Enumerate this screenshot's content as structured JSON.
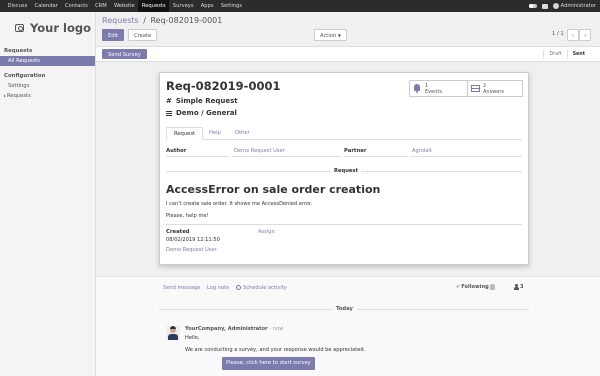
{
  "topbar": {
    "menu": [
      "Discuss",
      "Calendar",
      "Contacts",
      "CRM",
      "Website",
      "Requests",
      "Surveys",
      "Apps",
      "Settings"
    ],
    "active_index": 5,
    "user": "Administrator"
  },
  "sidebar": {
    "logo": "Your logo",
    "sections": [
      {
        "title": "Requests",
        "items": [
          {
            "label": "All Requests",
            "active": true
          }
        ]
      },
      {
        "title": "Configuration",
        "items": [
          {
            "label": "Settings"
          },
          {
            "label": "Requests"
          }
        ]
      }
    ]
  },
  "breadcrumb": {
    "parent": "Requests",
    "separator": "/",
    "current": "Req-082019-0001"
  },
  "control_panel": {
    "edit_label": "Edit",
    "create_label": "Create",
    "action_label": "Action",
    "pager": "1 / 1"
  },
  "statusbar": {
    "survey_button": "Send Survey",
    "stages": [
      "Draft",
      "Sent"
    ],
    "current_stage": "Sent"
  },
  "form": {
    "title": "Req-082019-0001",
    "type": "Simple Request",
    "category": "Demo / General",
    "stat_buttons": [
      {
        "count": "1",
        "label": "Events",
        "icon": "bell-icon"
      },
      {
        "count": "2",
        "label": "Answers",
        "icon": "list-icon"
      }
    ],
    "tabs": [
      "Request",
      "Help",
      "Other"
    ],
    "author_label": "Author",
    "author_value": "Demo Request User",
    "partner_label": "Partner",
    "partner_value": "Agrolait",
    "request_separator": "Request",
    "request_heading": "AccessError on sale order creation",
    "request_lines": [
      "I can't create sale order. It shows me AccessDenied error.",
      "Please, help me!"
    ],
    "created_label": "Created",
    "created_date": "08/02/2019 12:11:50",
    "created_by": "Demo Request User",
    "assign_label": "Assign"
  },
  "chatter": {
    "send_message": "Send message",
    "log_note": "Log note",
    "schedule_activity": "Schedule activity",
    "following": "Following",
    "followers_count": "3",
    "date_separator": "Today",
    "message": {
      "author": "YourCompany, Administrator",
      "time": "- now",
      "greeting": "Hello,",
      "body": "We are conducting a survey, and your response would be appreciated.",
      "cta": "Please, click here to start survey"
    }
  },
  "colors": {
    "accent": "#7c7bad",
    "topbar": "#2c2c2c",
    "primary_text": "#333333"
  }
}
